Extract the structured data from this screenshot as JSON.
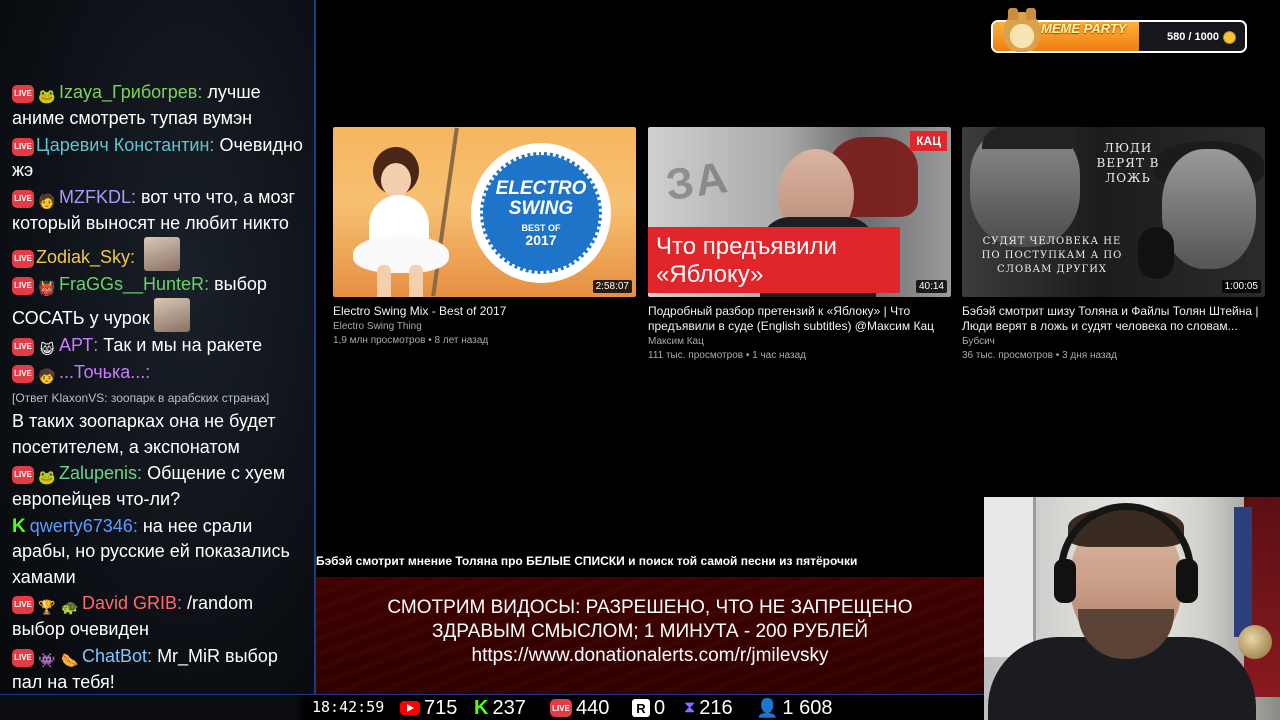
{
  "chat": {
    "messages": [
      {
        "badge": "live",
        "emotes": [
          "🐸"
        ],
        "user": "Izaya_Грибогрев",
        "color": "#7bd35a",
        "text": "лучше аниме смотреть тупая вумэн"
      },
      {
        "badge": "live",
        "emotes": [],
        "user": "Царевич Константин",
        "color": "#5ec5d1",
        "text": "Очевидно жэ"
      },
      {
        "badge": "live",
        "emotes": [
          "🧑"
        ],
        "user": "MZFKDL",
        "color": "#a89cff",
        "text": "вот что что, а мозг который выносят не любит никто"
      },
      {
        "badge": "live",
        "emotes": [],
        "user": "Zodiak_Sky",
        "color": "#f2c94c",
        "text": "",
        "avatar": true
      },
      {
        "badge": "live",
        "emotes": [
          "👹"
        ],
        "user": "FraGGs__HunteR",
        "color": "#67d46a",
        "text": "выбор СОСАТЬ у чурок",
        "avatar": true
      },
      {
        "badge": "live",
        "emotes": [
          "😸"
        ],
        "user": "АРТ",
        "color": "#c97cff",
        "text": "Так и мы на ракете"
      },
      {
        "badge": "live",
        "emotes": [
          "🧒"
        ],
        "user": "...Точька...",
        "color": "#c97cff",
        "text": ""
      },
      {
        "reply": "[Ответ KlaxonVS: зоопарк в арабских странах]",
        "text": "В таких зоопарках она не будет посетителем, а экспонатом"
      },
      {
        "badge": "live",
        "emotes": [
          "🐸"
        ],
        "user": "Zalupenis",
        "color": "#6ad68f",
        "text": "Общение с хуем европейцев что-ли?"
      },
      {
        "badge": "kick",
        "emotes": [],
        "user": "qwerty67346",
        "color": "#5b9cff",
        "text": "на нее срали арабы, но русские ей показались хамами"
      },
      {
        "badge": "live",
        "emotes": [
          "🏆",
          "🐢"
        ],
        "user": "David GRIB",
        "color": "#ff6a6a",
        "text": "/random выбор очевиден"
      },
      {
        "badge": "live",
        "emotes": [
          "👾",
          "🌭"
        ],
        "user": "ChatBot",
        "color": "#7ec8ff",
        "text": "Mr_MiR выбор пал на тебя!",
        "bold_first": "Mr_MiR"
      }
    ]
  },
  "videos": [
    {
      "title": "Electro Swing Mix - Best of 2017",
      "channel": "Electro Swing Thing",
      "meta": "1,9 млн просмотров • 8 лет назад",
      "duration": "2:58:07",
      "thumb": {
        "line1": "ELECTRO",
        "line2": "SWING",
        "line3": "BEST OF",
        "line4": "2017"
      }
    },
    {
      "title": "Подробный разбор претензий к «Яблоку» | Что предъявили в суде (English subtitles) @Максим Кац",
      "channel": "Максим Кац",
      "meta": "111 тыс. просмотров • 1 час назад",
      "duration": "40:14",
      "thumb": {
        "badge": "КАЦ",
        "line1": "Что предъявили",
        "line2": "«Яблоку»",
        "bg_word": "ЗА"
      }
    },
    {
      "title": "Бэбэй смотрит шизу Толяна и Файлы Толян Штейна | Люди верят в ложь и судят человека по словам...",
      "channel": "Бубсич",
      "meta": "36 тыс. просмотров • 3 дня назад",
      "duration": "1:00:05",
      "thumb": {
        "top": "ЛЮДИ ВЕРЯТ В ЛОЖЬ",
        "bottom": "СУДЯТ ЧЕЛОВЕКА НЕ ПО ПОСТУПКАМ А ПО СЛОВАМ ДРУГИХ"
      }
    }
  ],
  "meme_party": {
    "title": "MEME PARTY",
    "count": "580 / 1000",
    "progress": 0.58
  },
  "now_playing": "Бэбэй смотрит мнение Толяна про БЕЛЫЕ СПИСКИ и поиск той самой песни из пятёрочки",
  "donation": {
    "line1": "СМОТРИМ ВИДОСЫ: РАЗРЕШЕНО, ЧТО НЕ ЗАПРЕЩЕНО",
    "line2": "ЗДРАВЫМ СМЫСЛОМ; 1 МИНУТА - 200 РУБЛЕЙ",
    "line3": "https://www.donationalerts.com/r/jmilevsky"
  },
  "stats": {
    "clock": "18:42:59",
    "youtube": "715",
    "kick": "237",
    "vk": "440",
    "rutube": "0",
    "twitch": "216",
    "total": "1 608"
  },
  "badges": {
    "live": "LIVE"
  }
}
